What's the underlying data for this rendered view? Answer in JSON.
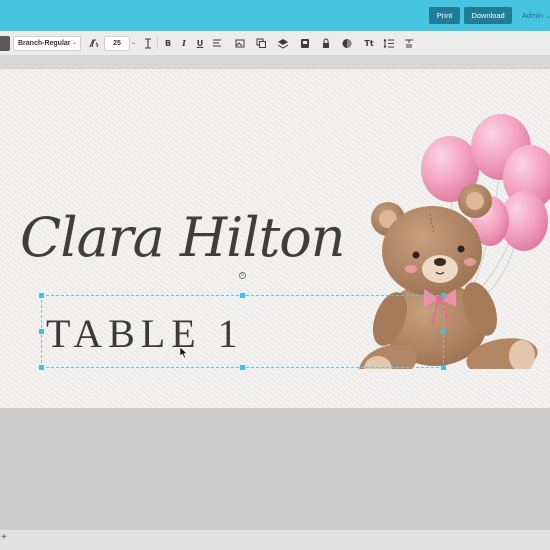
{
  "header": {
    "print_label": "Print",
    "download_label": "Download",
    "admin_label": "Admin",
    "accent_color": "#46c4e2",
    "button_color": "#217c96"
  },
  "toolbar": {
    "font_family": "Branch-Regular",
    "font_size": "25",
    "bold_label": "B",
    "italic_label": "I",
    "underline_label": "U",
    "text_style_label": "Tt",
    "icons": [
      "font-style-icon",
      "text-height-icon",
      "bold-icon",
      "italic-icon",
      "underline-icon",
      "image-icon",
      "duplicate-icon",
      "layers-icon",
      "stack-icon",
      "lock-icon",
      "color-fill-icon",
      "text-transform-icon",
      "line-spacing-icon",
      "text-case-icon"
    ]
  },
  "card": {
    "name": "Clara Hilton",
    "table": "TABLE 1",
    "illustration": "teddy-bear-with-pink-balloons"
  },
  "footer": {
    "add_label": "+"
  }
}
